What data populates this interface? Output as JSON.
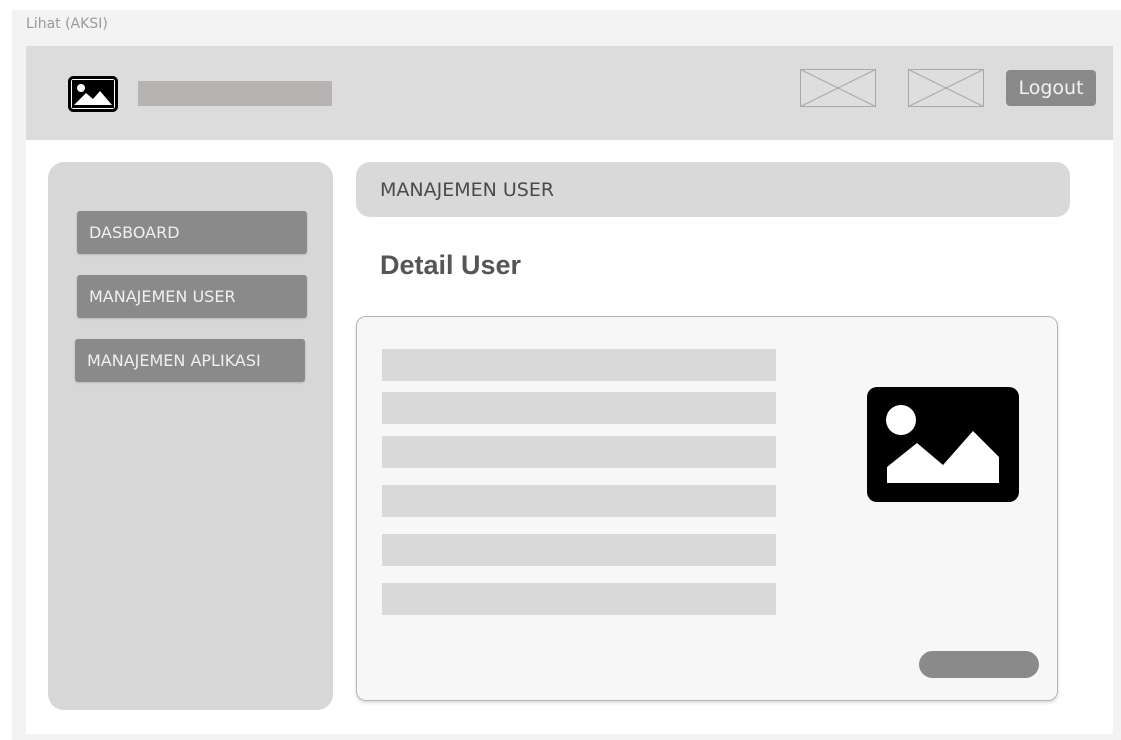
{
  "frame": {
    "label": "Lihat (AKSI)"
  },
  "header": {
    "logout_label": "Logout"
  },
  "sidebar": {
    "items": [
      {
        "label": "DASBOARD"
      },
      {
        "label": "MANAJEMEN USER"
      },
      {
        "label": "MANAJEMEN APLIKASI"
      }
    ]
  },
  "main": {
    "section_title": "MANAJEMEN USER",
    "page_title": "Detail User"
  },
  "icons": {
    "logo": "image-icon",
    "placeholder": "image-placeholder-icon",
    "profile": "image-icon"
  },
  "colors": {
    "header_bg": "#dcdcdc",
    "sidebar_bg": "#d7d7d7",
    "button_bg": "#8a8a8a",
    "field_bg": "#d9d9d9"
  }
}
